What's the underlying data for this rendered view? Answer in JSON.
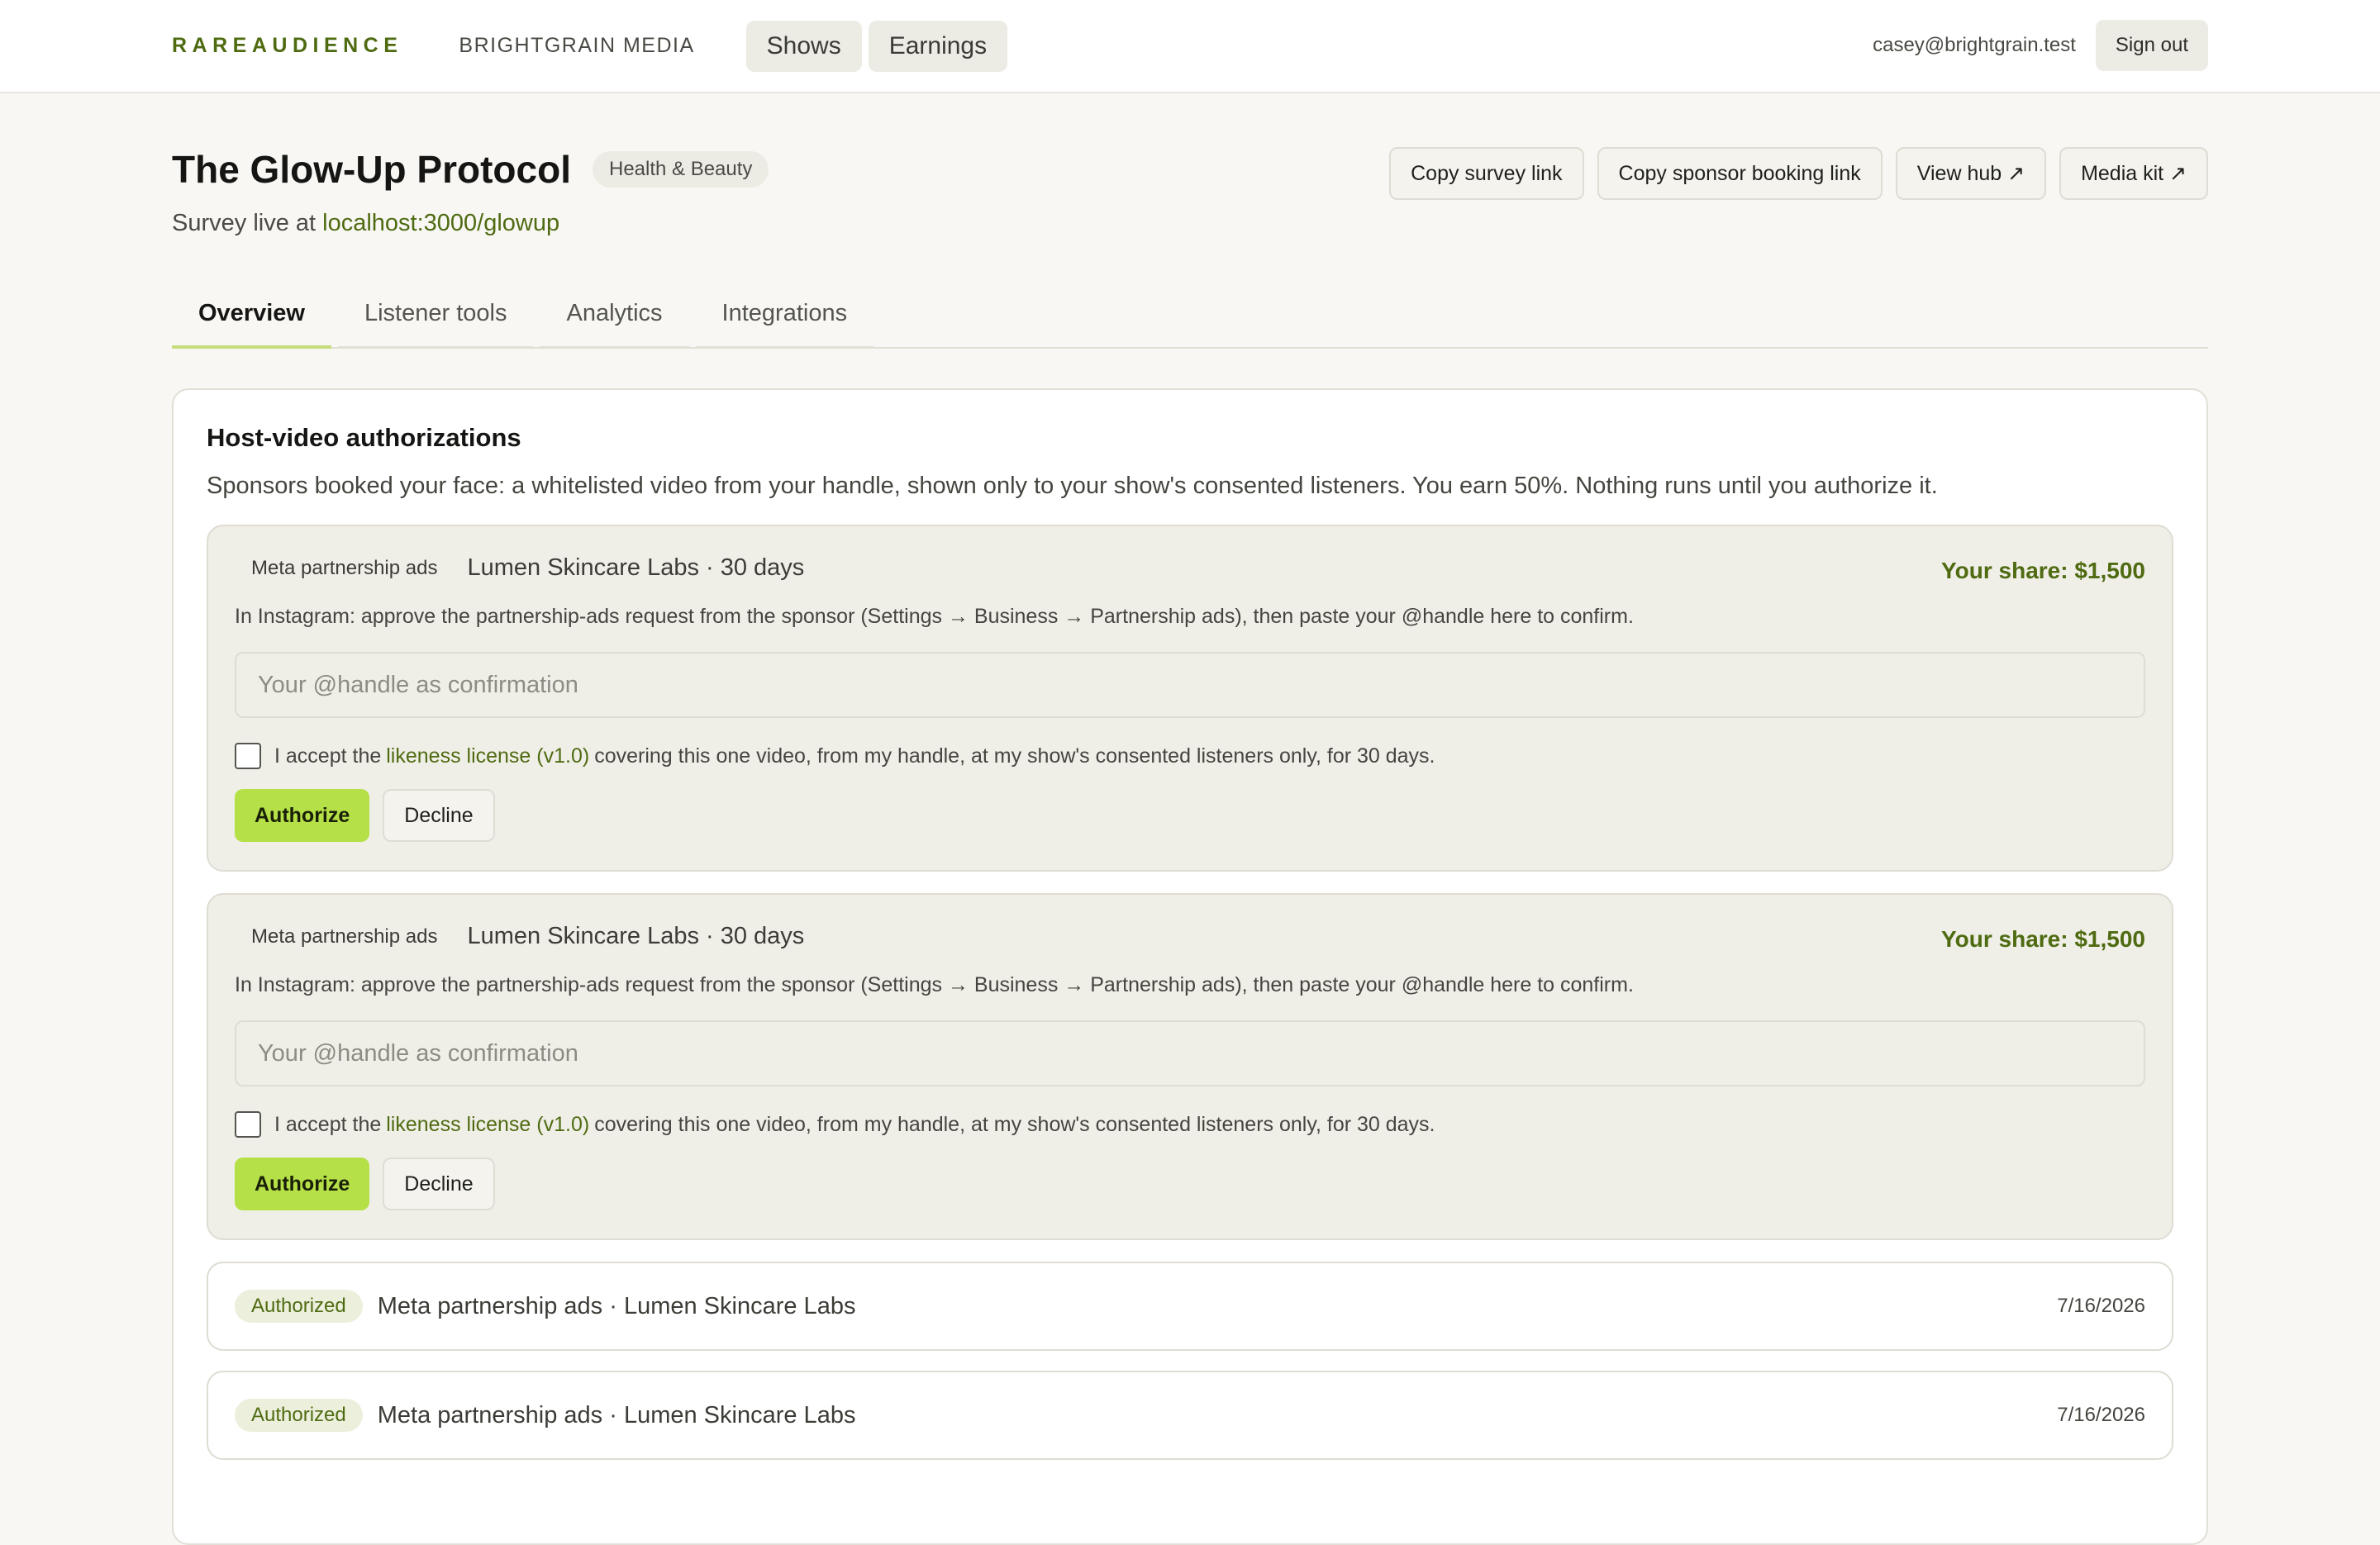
{
  "nav": {
    "brand": "RAREAUDIENCE",
    "org": "BRIGHTGRAIN MEDIA",
    "items": [
      {
        "label": "Shows"
      },
      {
        "label": "Earnings"
      }
    ],
    "email": "casey@brightgrain.test",
    "sign_out": "Sign out"
  },
  "show": {
    "title": "The Glow-Up Protocol",
    "category": "Health & Beauty",
    "survey_prefix": "Survey live at",
    "survey_link": "localhost:3000/glowup"
  },
  "actions": {
    "copy_survey": "Copy survey link",
    "copy_booking": "Copy sponsor booking link",
    "view_hub": "View hub ↗",
    "media_kit": "Media kit ↗"
  },
  "tabs": [
    {
      "label": "Overview",
      "active": true
    },
    {
      "label": "Listener tools"
    },
    {
      "label": "Analytics"
    },
    {
      "label": "Integrations"
    }
  ],
  "authorizations": {
    "title": "Host-video authorizations",
    "description": "Sponsors booked your face: a whitelisted video from your handle, shown only to your show's consented listeners. You earn 50%. Nothing runs until you authorize it.",
    "pending": [
      {
        "platform": "Meta partnership ads",
        "sponsor": "Lumen Skincare Labs · 30 days",
        "share": "Your share: $1,500",
        "instructions": "In Instagram: approve the partnership-ads request from the sponsor (Settings → Business → Partnership ads), then paste your @handle here to confirm.",
        "input_placeholder": "Your @handle as confirmation",
        "license_prefix": "I accept the",
        "license_link": "likeness license (v1.0)",
        "license_suffix": "covering this one video, from my handle, at my show's consented listeners only, for 30 days.",
        "authorize": "Authorize",
        "decline": "Decline"
      },
      {
        "platform": "Meta partnership ads",
        "sponsor": "Lumen Skincare Labs · 30 days",
        "share": "Your share: $1,500",
        "instructions": "In Instagram: approve the partnership-ads request from the sponsor (Settings → Business → Partnership ads), then paste your @handle here to confirm.",
        "input_placeholder": "Your @handle as confirmation",
        "license_prefix": "I accept the",
        "license_link": "likeness license (v1.0)",
        "license_suffix": "covering this one video, from my handle, at my show's consented listeners only, for 30 days.",
        "authorize": "Authorize",
        "decline": "Decline"
      }
    ],
    "completed": [
      {
        "status": "Authorized",
        "text": "Meta partnership ads · Lumen Skincare Labs",
        "date": "7/16/2026"
      },
      {
        "status": "Authorized",
        "text": "Meta partnership ads · Lumen Skincare Labs",
        "date": "7/16/2026"
      }
    ]
  },
  "colors": {
    "accent": "#4f6b12",
    "authorize_button": "#b5e047",
    "background": "#f8f7f3"
  }
}
